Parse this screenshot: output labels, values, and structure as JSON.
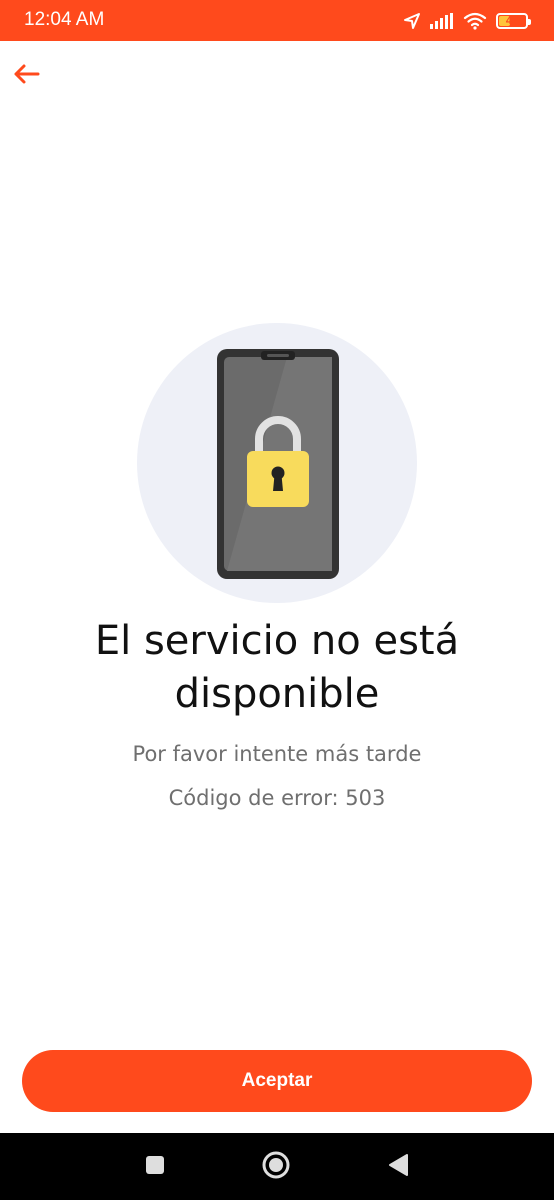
{
  "status_bar": {
    "time": "12:04 AM",
    "battery_level": "42",
    "battery_fraction": 0.42,
    "icons": [
      "location-arrow-icon",
      "signal-bars-icon",
      "wifi-icon",
      "battery-icon"
    ]
  },
  "header": {
    "back_icon": "arrow-left-icon"
  },
  "illustration": {
    "icon": "phone-lock-illustration"
  },
  "message": {
    "title": "El servicio no está disponible",
    "subtitle": "Por favor intente más tarde",
    "error_code": "Código de error: 503"
  },
  "actions": {
    "accept_label": "Aceptar"
  },
  "nav_bar": {
    "items": [
      "recents-square-icon",
      "home-circle-icon",
      "back-triangle-icon"
    ]
  },
  "colors": {
    "brand": "#ff4a1c",
    "circle_bg": "#eef0f7",
    "lock_yellow": "#f8db5c",
    "title_text": "#111111",
    "secondary_text": "#6f6f6f"
  }
}
